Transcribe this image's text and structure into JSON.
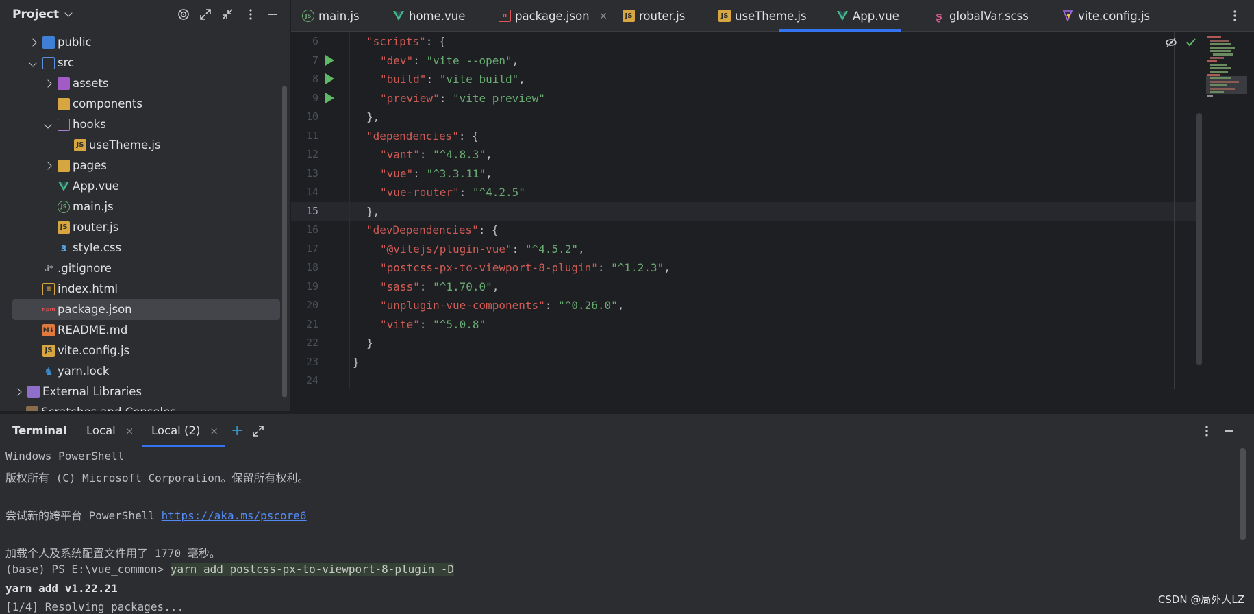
{
  "project_panel": {
    "title": "Project",
    "tree": [
      {
        "label": "public",
        "icon": "folder-icon"
      },
      {
        "label": "src",
        "icon": "folder-icon"
      },
      {
        "label": "assets",
        "icon": "folder-icon"
      },
      {
        "label": "components",
        "icon": "folder-icon"
      },
      {
        "label": "hooks",
        "icon": "folder-icon"
      },
      {
        "label": "useTheme.js",
        "icon": "js-file-icon"
      },
      {
        "label": "pages",
        "icon": "folder-icon"
      },
      {
        "label": "App.vue",
        "icon": "vue-file-icon"
      },
      {
        "label": "main.js",
        "icon": "node-file-icon"
      },
      {
        "label": "router.js",
        "icon": "js-file-icon"
      },
      {
        "label": "style.css",
        "icon": "css-file-icon"
      },
      {
        "label": ".gitignore",
        "icon": "gitignore-file-icon"
      },
      {
        "label": "index.html",
        "icon": "html-file-icon"
      },
      {
        "label": "package.json",
        "icon": "npm-file-icon"
      },
      {
        "label": "README.md",
        "icon": "markdown-file-icon"
      },
      {
        "label": "vite.config.js",
        "icon": "js-file-icon"
      },
      {
        "label": "yarn.lock",
        "icon": "yarn-file-icon"
      },
      {
        "label": "External Libraries",
        "icon": "libraries-icon"
      },
      {
        "label": "Scratches and Consoles",
        "icon": "scratches-icon"
      }
    ]
  },
  "tabs": [
    {
      "label": "main.js"
    },
    {
      "label": "home.vue"
    },
    {
      "label": "package.json",
      "close": "×"
    },
    {
      "label": "router.js"
    },
    {
      "label": "useTheme.js"
    },
    {
      "label": "App.vue"
    },
    {
      "label": "globalVar.scss"
    },
    {
      "label": "vite.config.js"
    }
  ],
  "editor": {
    "line_numbers": [
      "6",
      "7",
      "8",
      "9",
      "10",
      "11",
      "12",
      "13",
      "14",
      "15",
      "16",
      "17",
      "18",
      "19",
      "20",
      "21",
      "22",
      "23",
      "24"
    ],
    "current_line": "15",
    "lines": [
      {
        "key": "\"scripts\"",
        "sep": ": {",
        "val": ""
      },
      {
        "key": "\"dev\"",
        "sep": ": ",
        "val": "\"vite --open\"",
        "end": ","
      },
      {
        "key": "\"build\"",
        "sep": ": ",
        "val": "\"vite build\"",
        "end": ","
      },
      {
        "key": "\"preview\"",
        "sep": ": ",
        "val": "\"vite preview\"",
        "end": ""
      },
      {
        "plain": "},"
      },
      {
        "key": "\"dependencies\"",
        "sep": ": {",
        "val": ""
      },
      {
        "key": "\"vant\"",
        "sep": ": ",
        "val": "\"^4.8.3\"",
        "end": ","
      },
      {
        "key": "\"vue\"",
        "sep": ": ",
        "val": "\"^3.3.11\"",
        "end": ","
      },
      {
        "key": "\"vue-router\"",
        "sep": ": ",
        "val": "\"^4.2.5\"",
        "end": ""
      },
      {
        "plain": "},"
      },
      {
        "key": "\"devDependencies\"",
        "sep": ": {",
        "val": ""
      },
      {
        "key": "\"@vitejs/plugin-vue\"",
        "sep": ": ",
        "val": "\"^4.5.2\"",
        "end": ","
      },
      {
        "key": "\"postcss-px-to-viewport-8-plugin\"",
        "sep": ": ",
        "val": "\"^1.2.3\"",
        "end": ","
      },
      {
        "key": "\"sass\"",
        "sep": ": ",
        "val": "\"^1.70.0\"",
        "end": ","
      },
      {
        "key": "\"unplugin-vue-components\"",
        "sep": ": ",
        "val": "\"^0.26.0\"",
        "end": ","
      },
      {
        "key": "\"vite\"",
        "sep": ": ",
        "val": "\"^5.0.8\"",
        "end": ""
      },
      {
        "plain": "}"
      },
      {
        "plain": "}"
      },
      {
        "plain": ""
      }
    ]
  },
  "terminal": {
    "title": "Terminal",
    "tabs": [
      {
        "label": "Local",
        "close": "×"
      },
      {
        "label": "Local (2)",
        "close": "×"
      }
    ],
    "add": "+",
    "lines": {
      "l1": "Windows PowerShell",
      "l2": "版权所有 (C) Microsoft Corporation。保留所有权利。",
      "l3_prefix": "尝试新的跨平台 PowerShell ",
      "l3_link": "https://aka.ms/pscore6",
      "l4": "加载个人及系统配置文件用了 1770 毫秒。",
      "l5_prompt": "(base) PS E:\\vue_common> ",
      "l5_cmd": "yarn add postcss-px-to-viewport-8-plugin -D",
      "l6": "yarn add v1.22.21",
      "l7": "[1/4] Resolving packages..."
    }
  },
  "watermark": "CSDN @局外人LZ"
}
